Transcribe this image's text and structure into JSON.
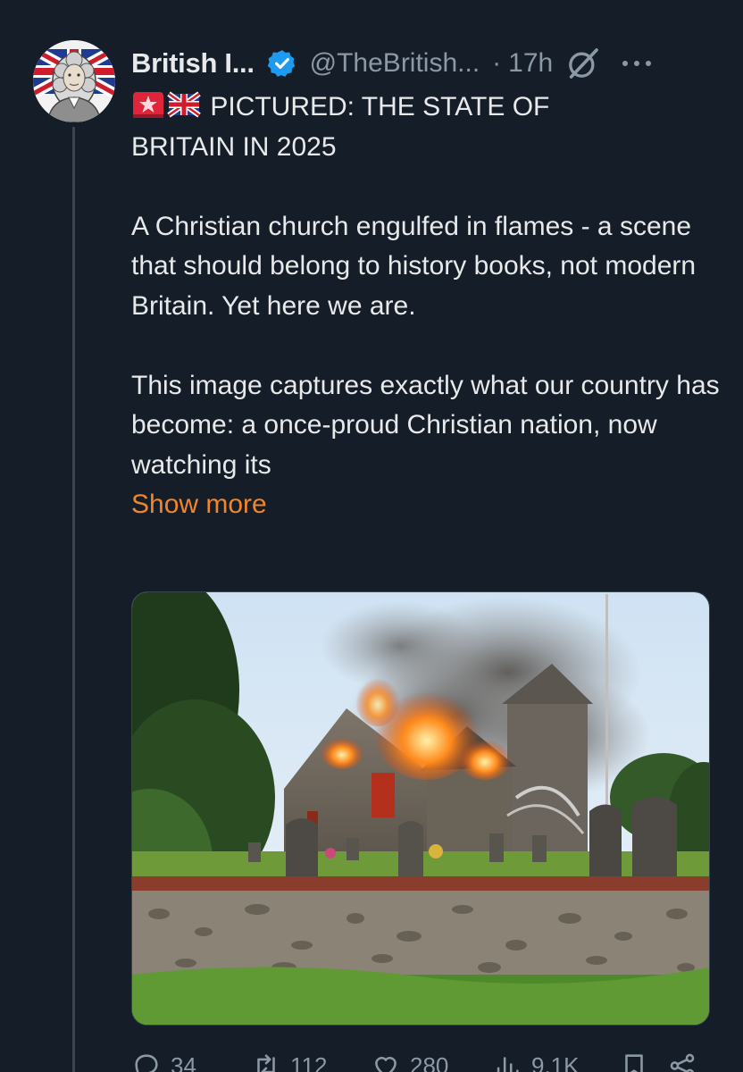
{
  "tweet": {
    "author": {
      "display_name": "British I...",
      "handle": "@TheBritish...",
      "verified": true,
      "avatar_icon": "bearded-man-union-jack-avatar"
    },
    "separator": "·",
    "time": "17h",
    "header_icons": [
      "grok-icon",
      "more-options-icon"
    ],
    "text": {
      "line1": "PICTURED: THE STATE OF",
      "line2": "BRITAIN IN 2025",
      "emojis": [
        "rotating-light-icon",
        "uk-flag-icon"
      ],
      "paragraph2": "A Christian church engulfed in flames - a scene that should belong to history books, not modern Britain. Yet here we are.",
      "paragraph3": "This image captures exactly what our country has become: a once-proud Christian nation, now watching its",
      "show_more": "Show more"
    },
    "media": {
      "image_icon": "burning-church-photo"
    },
    "actions": {
      "replies": "34",
      "retweets": "112",
      "likes": "280",
      "views": "9.1K"
    }
  },
  "colors": {
    "background": "#151d28",
    "text": "#e7e9ea",
    "muted": "#8b98a5",
    "link_accent": "#f0852c",
    "verified": "#1d9bf0"
  }
}
